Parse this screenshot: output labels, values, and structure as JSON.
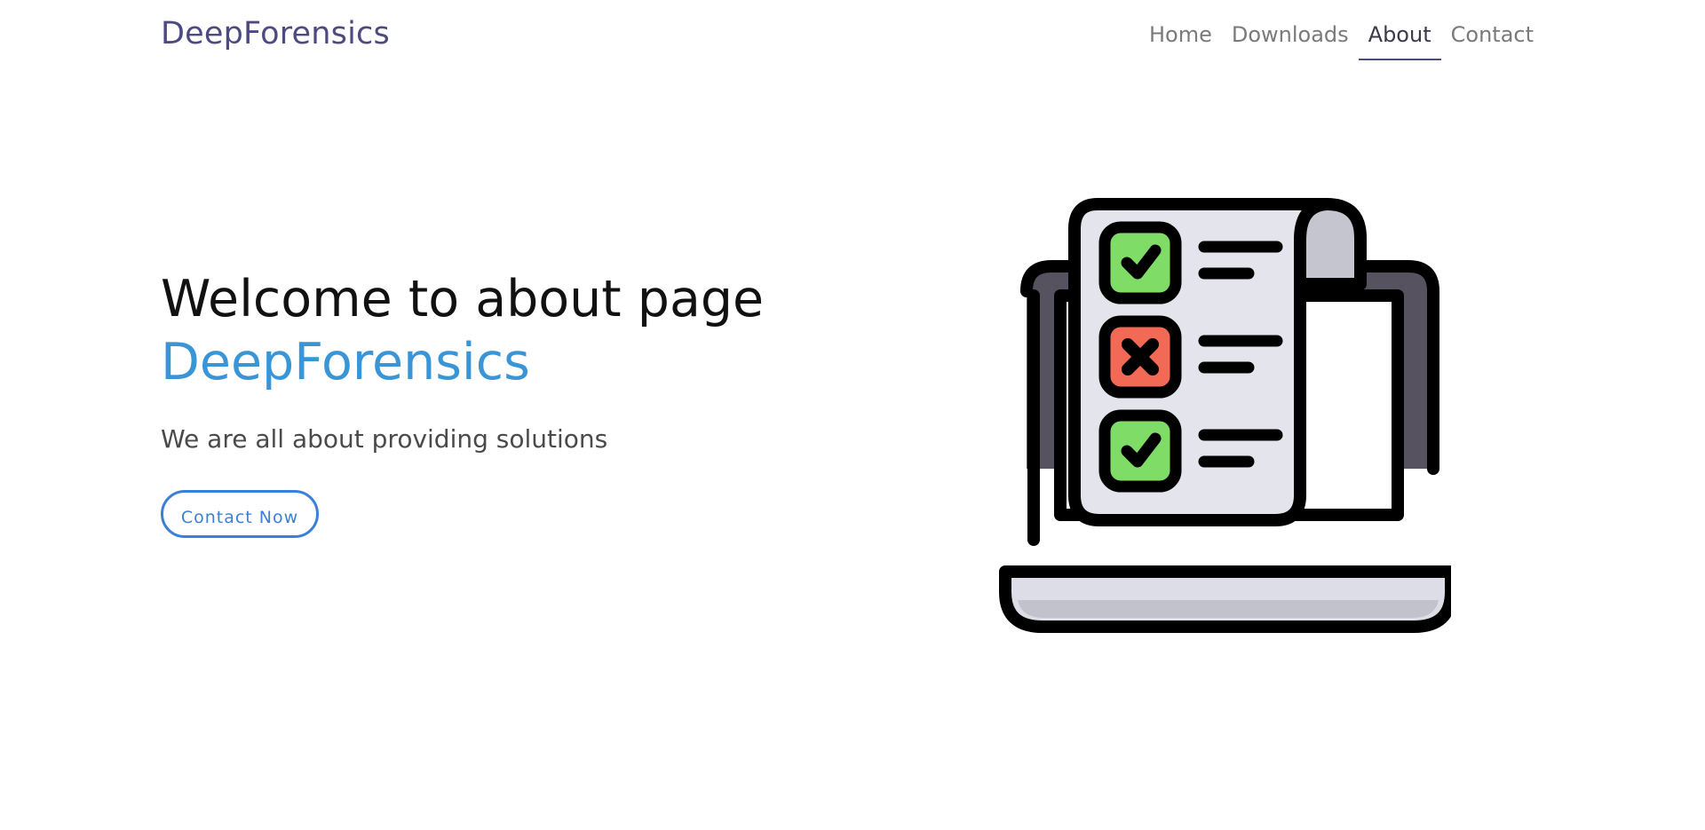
{
  "navbar": {
    "brand": "DeepForensics",
    "links": [
      {
        "label": "Home",
        "active": false
      },
      {
        "label": "Downloads",
        "active": false
      },
      {
        "label": "About",
        "active": true
      },
      {
        "label": "Contact",
        "active": false
      }
    ]
  },
  "hero": {
    "title": "Welcome to about page",
    "brand": "DeepForensics",
    "subtitle": "We are all about providing solutions",
    "cta_label": "Contact Now"
  },
  "illustration": {
    "icon": "laptop-checklist-icon",
    "colors": {
      "outline": "#000000",
      "laptop_body": "#57525f",
      "laptop_base": "#dcdde6",
      "base_shadow": "#c1c2cb",
      "paper": "#e4e5ec",
      "paper_roll": "#c4c5ce",
      "check_green": "#7fdc67",
      "cross_red": "#f26a55"
    }
  },
  "colors": {
    "brand": "#4d4a80",
    "accent": "#3a95d6",
    "cta": "#3b7fd6"
  }
}
